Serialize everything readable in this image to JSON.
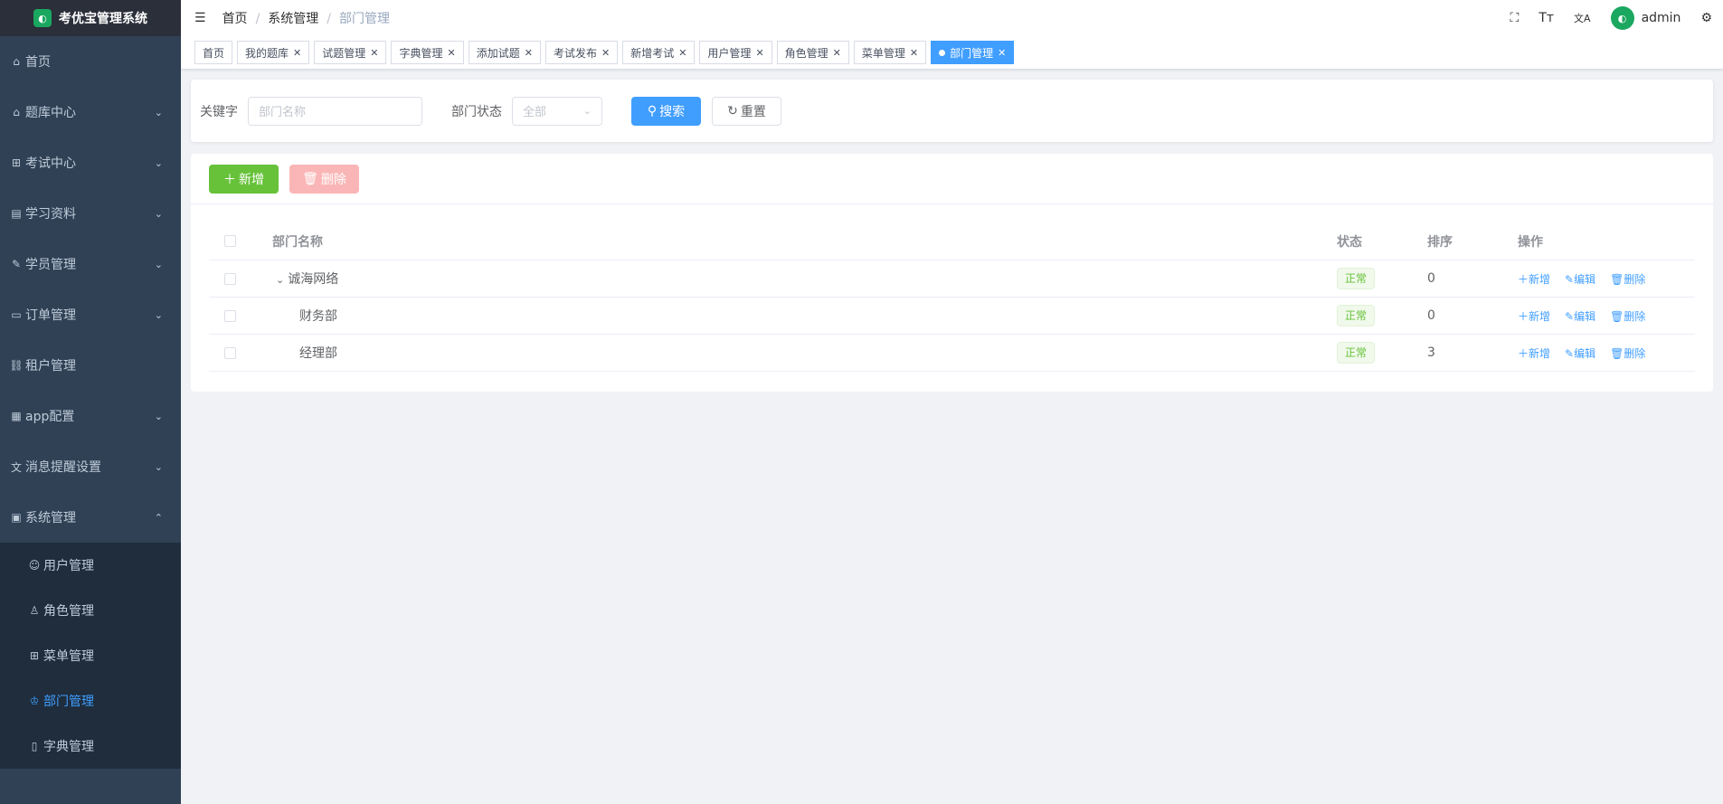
{
  "app": {
    "title": "考优宝管理系统",
    "logo_glyph": "◐"
  },
  "sidebar": {
    "items": [
      {
        "icon": "home-icon",
        "glyph": "⌂",
        "label": "首页",
        "arrow": ""
      },
      {
        "icon": "home-icon",
        "glyph": "⌂",
        "label": "题库中心",
        "arrow": "⌄"
      },
      {
        "icon": "grid-icon",
        "glyph": "⊞",
        "label": "考试中心",
        "arrow": "⌄"
      },
      {
        "icon": "document-icon",
        "glyph": "▤",
        "label": "学习资料",
        "arrow": "⌄"
      },
      {
        "icon": "edit-icon",
        "glyph": "✎",
        "label": "学员管理",
        "arrow": "⌄"
      },
      {
        "icon": "monitor-icon",
        "glyph": "▭",
        "label": "订单管理",
        "arrow": "⌄"
      },
      {
        "icon": "link-icon",
        "glyph": "⛓",
        "label": "租户管理",
        "arrow": ""
      },
      {
        "icon": "table-icon",
        "glyph": "▦",
        "label": "app配置",
        "arrow": "⌄"
      },
      {
        "icon": "language-icon",
        "glyph": "文",
        "label": "消息提醒设置",
        "arrow": "⌄"
      },
      {
        "icon": "system-icon",
        "glyph": "▣",
        "label": "系统管理",
        "arrow": "⌃"
      }
    ],
    "subitems": [
      {
        "icon": "user-icon",
        "glyph": "☺",
        "label": "用户管理"
      },
      {
        "icon": "peoples-icon",
        "glyph": "♙",
        "label": "角色管理"
      },
      {
        "icon": "menu-grid-icon",
        "glyph": "⊞",
        "label": "菜单管理"
      },
      {
        "icon": "tree-icon",
        "glyph": "♔",
        "label": "部门管理"
      },
      {
        "icon": "dict-icon",
        "glyph": "▯",
        "label": "字典管理"
      }
    ]
  },
  "navbar": {
    "breadcrumb": [
      "首页",
      "系统管理",
      "部门管理"
    ],
    "username": "admin",
    "hamburger_glyph": "☰",
    "fullscreen_glyph": "⛶",
    "size_glyph": "Tт",
    "lang_glyph": "文A",
    "settings_glyph": "⚙"
  },
  "tags": [
    {
      "label": "首页",
      "closable": false
    },
    {
      "label": "我的题库",
      "closable": true
    },
    {
      "label": "试题管理",
      "closable": true
    },
    {
      "label": "字典管理",
      "closable": true
    },
    {
      "label": "添加试题",
      "closable": true
    },
    {
      "label": "考试发布",
      "closable": true
    },
    {
      "label": "新增考试",
      "closable": true
    },
    {
      "label": "用户管理",
      "closable": true
    },
    {
      "label": "角色管理",
      "closable": true
    },
    {
      "label": "菜单管理",
      "closable": true
    },
    {
      "label": "部门管理",
      "closable": true,
      "active": true
    }
  ],
  "search": {
    "keyword_label": "关键字",
    "keyword_placeholder": "部门名称",
    "status_label": "部门状态",
    "status_value": "全部",
    "search_button": "搜索",
    "reset_button": "重置"
  },
  "toolbar": {
    "add_button": "新增",
    "delete_button": "删除"
  },
  "table": {
    "headers": {
      "name": "部门名称",
      "status": "状态",
      "sort": "排序",
      "ops": "操作"
    },
    "rows": [
      {
        "name": "诚海网络",
        "status": "正常",
        "sort": "0",
        "level": 0,
        "expandable": true
      },
      {
        "name": "财务部",
        "status": "正常",
        "sort": "0",
        "level": 1,
        "expandable": false
      },
      {
        "name": "经理部",
        "status": "正常",
        "sort": "3",
        "level": 1,
        "expandable": false
      }
    ],
    "ops": {
      "add": "新增",
      "edit": "编辑",
      "delete": "删除"
    }
  },
  "colors": {
    "primary": "#409eff",
    "success": "#67c23a",
    "sidebar_bg": "#304156",
    "active_menu": "#409eff"
  }
}
